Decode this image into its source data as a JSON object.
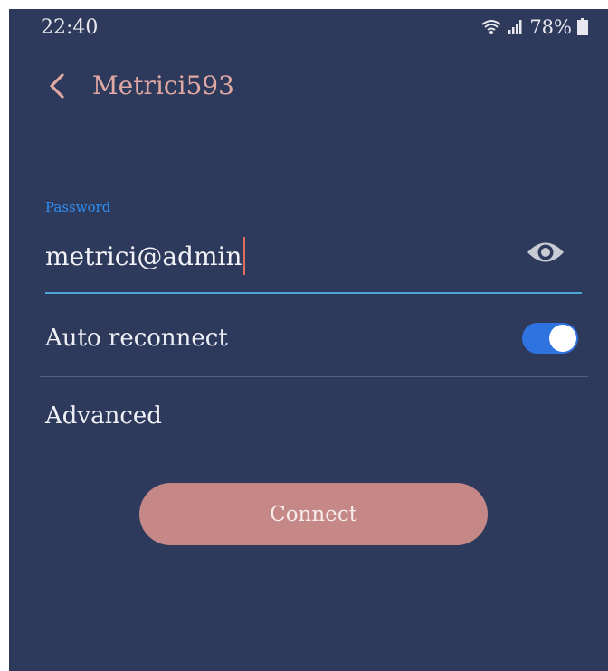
{
  "status_bar": {
    "time": "22:40",
    "battery_percent": "78%",
    "icons": [
      "wifi-icon",
      "signal-icon",
      "battery-icon"
    ]
  },
  "header": {
    "back_icon": "chevron-left-icon",
    "title": "Metrici593"
  },
  "password": {
    "label": "Password",
    "value": "metrici@admin",
    "visibility_icon": "eye-icon"
  },
  "auto_reconnect": {
    "label": "Auto reconnect",
    "enabled": true
  },
  "advanced": {
    "label": "Advanced"
  },
  "connect": {
    "label": "Connect"
  },
  "colors": {
    "background": "#2e3a5c",
    "accent_title": "#e0a8a3",
    "label_blue": "#2f8ff2",
    "underline": "#4fa4d8",
    "toggle_on": "#2f73e0",
    "connect_button": "#c68886"
  }
}
